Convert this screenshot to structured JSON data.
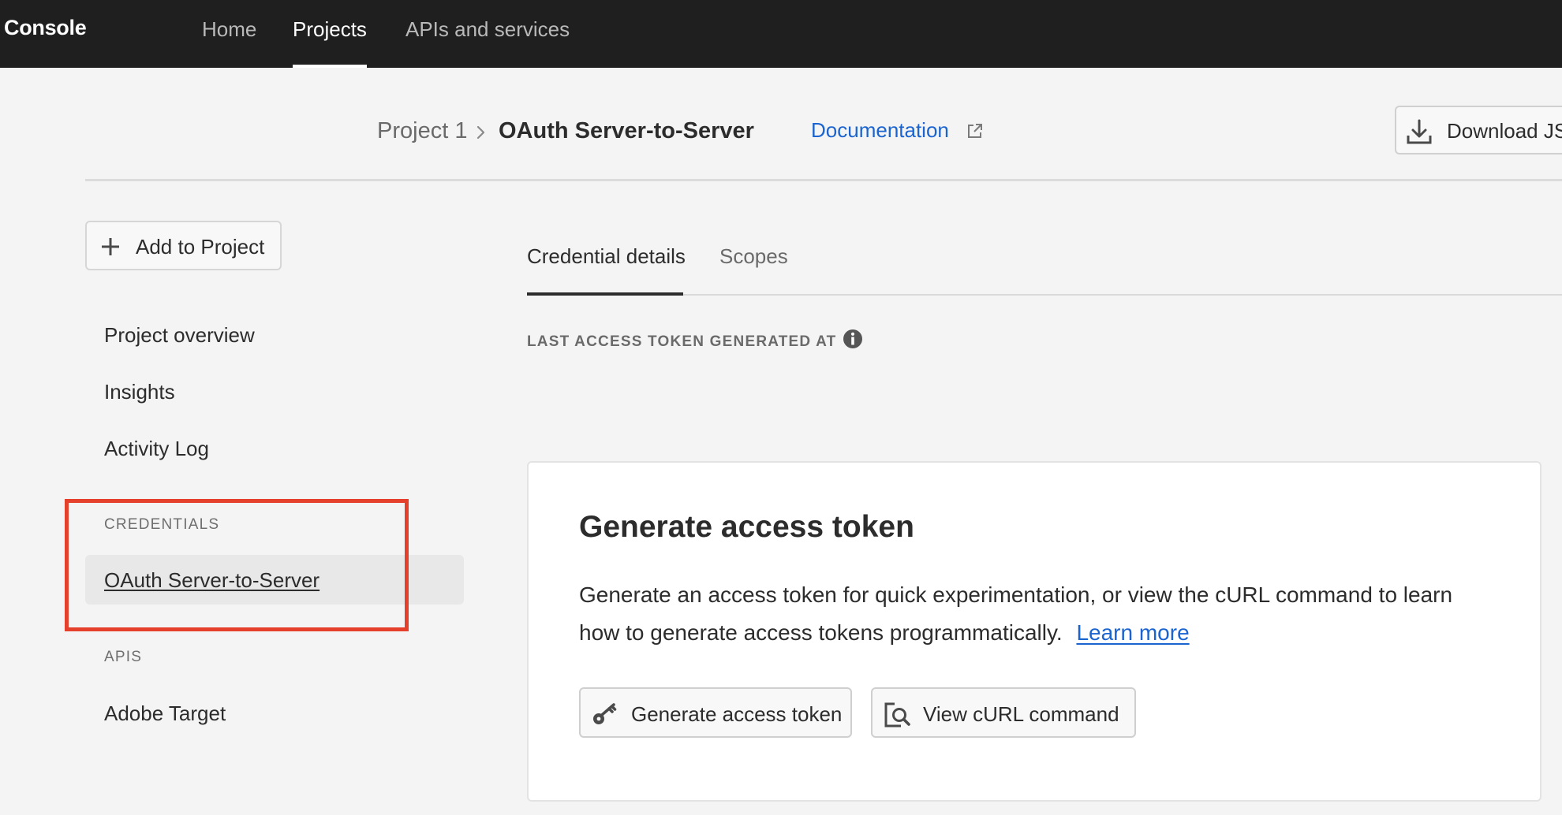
{
  "topbar": {
    "brand": "Console",
    "tabs": [
      {
        "label": "Home",
        "active": false
      },
      {
        "label": "Projects",
        "active": true
      },
      {
        "label": "APIs and services",
        "active": false
      }
    ]
  },
  "header": {
    "breadcrumb_parent": "Project 1",
    "breadcrumb_current": "OAuth Server-to-Server",
    "documentation_link": "Documentation",
    "download_button": "Download JS"
  },
  "sidebar": {
    "add_button": "Add to Project",
    "items": [
      {
        "label": "Project overview"
      },
      {
        "label": "Insights"
      },
      {
        "label": "Activity Log"
      }
    ],
    "credentials_heading": "CREDENTIALS",
    "credentials_selected": "OAuth Server-to-Server",
    "apis_heading": "APIS",
    "apis_items": [
      {
        "label": "Adobe Target"
      }
    ]
  },
  "content": {
    "tabs": [
      {
        "label": "Credential details",
        "active": true
      },
      {
        "label": "Scopes",
        "active": false
      }
    ],
    "section_label": "LAST ACCESS TOKEN GENERATED AT",
    "card": {
      "title": "Generate access token",
      "description": "Generate an access token for quick experimentation, or view the cURL command to learn how to generate access tokens programmatically.",
      "learn_more": "Learn more",
      "generate_button": "Generate access token",
      "curl_button": "View cURL command"
    }
  },
  "colors": {
    "topbar_bg": "#1f1f1f",
    "link": "#1b64d0",
    "highlight_border": "#e5402b",
    "page_bg": "#f4f4f4"
  },
  "icons": [
    "plus-icon",
    "chevron-right-icon",
    "external-link-icon",
    "download-icon",
    "info-icon",
    "key-icon",
    "search-document-icon"
  ]
}
